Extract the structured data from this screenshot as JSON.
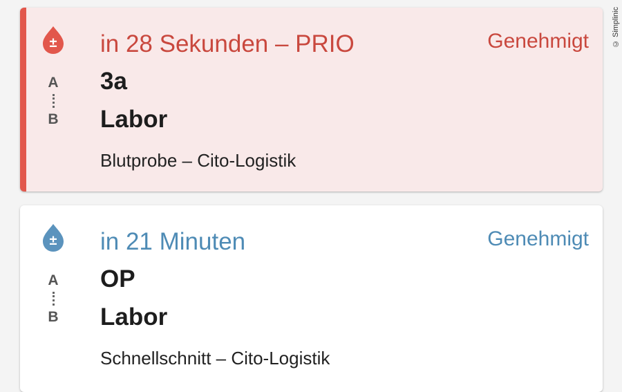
{
  "copyright": "© Simplinic",
  "cards": [
    {
      "time": "in 28 Sekunden – PRIO",
      "status": "Genehmigt",
      "from": "3a",
      "to": "Labor",
      "description": "Blutprobe – Cito-Logistik",
      "route_from_label": "A",
      "route_to_label": "B",
      "icon": "blood-drop-plus-minus-icon",
      "color": "#c9483e",
      "priority": true
    },
    {
      "time": "in 21 Minuten",
      "status": "Genehmigt",
      "from": "OP",
      "to": "Labor",
      "description": "Schnellschnitt – Cito-Logistik",
      "route_from_label": "A",
      "route_to_label": "B",
      "icon": "blood-drop-plus-minus-icon",
      "color": "#4e8bb5",
      "priority": false
    }
  ]
}
